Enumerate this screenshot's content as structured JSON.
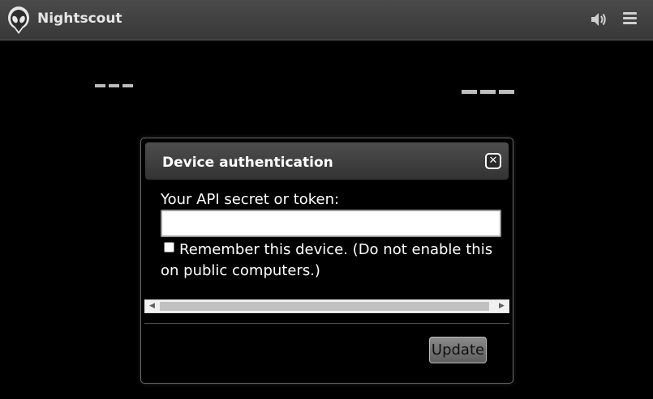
{
  "app": {
    "title": "Nightscout",
    "logo_icon": "alien-logo-icon",
    "volume_icon": "volume-icon",
    "menu_icon": "hamburger-menu-icon"
  },
  "dialog": {
    "title": "Device authentication",
    "close_icon": "close-icon",
    "field_label": "Your API secret or token:",
    "field_value": "",
    "remember_label": "Remember this device. (Do not enable this on public computers.)",
    "remember_checked": false,
    "update_label": "Update"
  },
  "colors": {
    "topbar": "#3f3f3f",
    "background": "#000000",
    "placeholder_dashes": "#bdbdbd"
  }
}
